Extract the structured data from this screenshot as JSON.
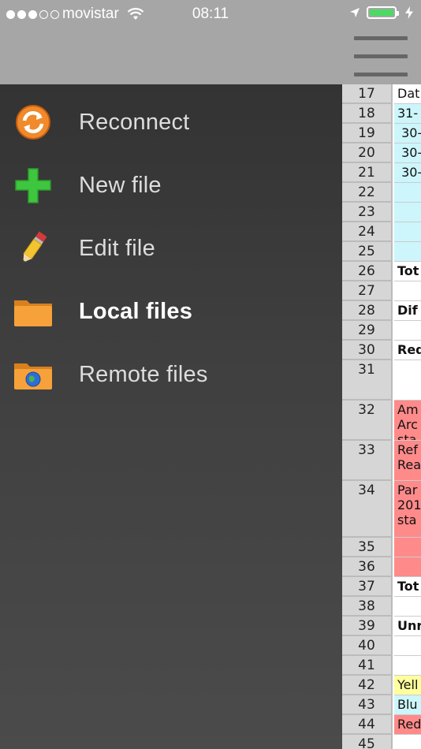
{
  "status_bar": {
    "carrier": "movistar",
    "time": "08:11",
    "signal_filled": 3,
    "signal_empty": 2,
    "battery_level": 1.0,
    "icons": [
      "wifi-icon",
      "location-arrow-icon",
      "battery-icon",
      "charging-bolt-icon"
    ]
  },
  "toolbar": {
    "menu_icon": "hamburger-menu-icon"
  },
  "menu": {
    "items": [
      {
        "label": "Reconnect",
        "icon": "reconnect-icon"
      },
      {
        "label": "New file",
        "icon": "plus-icon"
      },
      {
        "label": "Edit file",
        "icon": "pencil-icon"
      },
      {
        "label": "Local files",
        "icon": "folder-icon",
        "active": true
      },
      {
        "label": "Remote files",
        "icon": "globe-folder-icon"
      }
    ]
  },
  "sheet": {
    "rows": [
      {
        "num": "17",
        "text": "Dat",
        "bg": "#ffffff",
        "bold": false
      },
      {
        "num": "18",
        "text": "31-",
        "bg": "#ccf6fb",
        "bold": false
      },
      {
        "num": "19",
        "text": " 30-",
        "bg": "#ccf6fb",
        "bold": false
      },
      {
        "num": "20",
        "text": " 30-",
        "bg": "#ccf6fb",
        "bold": false
      },
      {
        "num": "21",
        "text": " 30-",
        "bg": "#ccf6fb",
        "bold": false
      },
      {
        "num": "22",
        "text": "",
        "bg": "#ccf6fb",
        "bold": false
      },
      {
        "num": "23",
        "text": "",
        "bg": "#ccf6fb",
        "bold": false
      },
      {
        "num": "24",
        "text": "",
        "bg": "#ccf6fb",
        "bold": false
      },
      {
        "num": "25",
        "text": "",
        "bg": "#ccf6fb",
        "bold": false
      },
      {
        "num": "26",
        "text": "Tot",
        "bg": "#ffffff",
        "bold": true
      },
      {
        "num": "27",
        "text": "",
        "bg": "#ffffff",
        "bold": false
      },
      {
        "num": "28",
        "text": "Dif",
        "bg": "#ffffff",
        "bold": true
      },
      {
        "num": "29",
        "text": "",
        "bg": "#ffffff",
        "bold": false
      },
      {
        "num": "30",
        "text": "Red",
        "bg": "#ffffff",
        "bold": true
      },
      {
        "num": "31",
        "text": "",
        "bg": "#ffffff",
        "bold": false
      },
      {
        "num": "32",
        "text": "Am\nArc\nsta",
        "bg": "#ff8a8a",
        "bold": false
      },
      {
        "num": "33",
        "text": "Ref\nRea",
        "bg": "#ff8a8a",
        "bold": false
      },
      {
        "num": "34",
        "text": "Par\n201\nsta",
        "bg": "#ff8a8a",
        "bold": false
      },
      {
        "num": "35",
        "text": "",
        "bg": "#ff8a8a",
        "bold": false
      },
      {
        "num": "36",
        "text": "",
        "bg": "#ff8a8a",
        "bold": false
      },
      {
        "num": "37",
        "text": "Tot",
        "bg": "#ffffff",
        "bold": true
      },
      {
        "num": "38",
        "text": "",
        "bg": "#ffffff",
        "bold": false
      },
      {
        "num": "39",
        "text": "Unr",
        "bg": "#ffffff",
        "bold": true
      },
      {
        "num": "40",
        "text": "",
        "bg": "#ffffff",
        "bold": false
      },
      {
        "num": "41",
        "text": "",
        "bg": "#ffffff",
        "bold": false
      },
      {
        "num": "42",
        "text": "Yell",
        "bg": "#ffff9e",
        "bold": false
      },
      {
        "num": "43",
        "text": "Blu",
        "bg": "#ccf6fb",
        "bold": false
      },
      {
        "num": "44",
        "text": "Red",
        "bg": "#ff8a8a",
        "bold": false
      },
      {
        "num": "45",
        "text": "",
        "bg": "#ffffff",
        "bold": false
      }
    ]
  }
}
